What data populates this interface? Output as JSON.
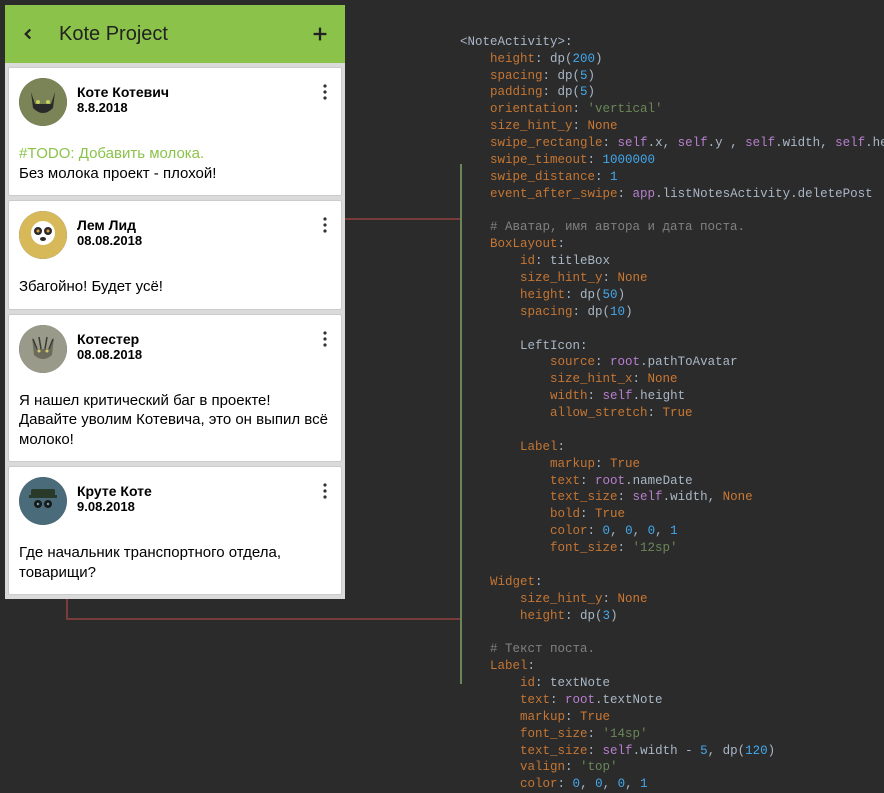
{
  "appbar": {
    "title": "Kote Project"
  },
  "posts": [
    {
      "author": "Коте Котевич",
      "date": "8.8.2018",
      "todo": "#TODO: Добавить молока.",
      "text": "Без молока проект - плохой!",
      "avatar": "cat-dark"
    },
    {
      "author": "Лем Лид",
      "date": "08.08.2018",
      "todo": "",
      "text": "Збагойно! Будет усё!",
      "avatar": "lemur"
    },
    {
      "author": "Котестер",
      "date": "08.08.2018",
      "todo": "",
      "text": "Я нашел критический баг в проекте! Давайте уволим Котевича, это он выпил всё молоко!",
      "avatar": "cat-grey"
    },
    {
      "author": "Круте Коте",
      "date": "9.08.2018",
      "todo": "",
      "text": "Где начальник транспортного отдела, товарищи?",
      "avatar": "cat-cap"
    }
  ],
  "code": {
    "lines": [
      [
        {
          "t": "id",
          "v": "<NoteActivity>:"
        }
      ],
      [
        {
          "t": "prop",
          "v": "    height"
        },
        {
          "t": "id",
          "v": ": dp("
        },
        {
          "t": "num",
          "v": "200"
        },
        {
          "t": "id",
          "v": ")"
        }
      ],
      [
        {
          "t": "prop",
          "v": "    spacing"
        },
        {
          "t": "id",
          "v": ": dp("
        },
        {
          "t": "num",
          "v": "5"
        },
        {
          "t": "id",
          "v": ")"
        }
      ],
      [
        {
          "t": "prop",
          "v": "    padding"
        },
        {
          "t": "id",
          "v": ": dp("
        },
        {
          "t": "num",
          "v": "5"
        },
        {
          "t": "id",
          "v": ")"
        }
      ],
      [
        {
          "t": "prop",
          "v": "    orientation"
        },
        {
          "t": "id",
          "v": ": "
        },
        {
          "t": "str",
          "v": "'vertical'"
        }
      ],
      [
        {
          "t": "prop",
          "v": "    size_hint_y"
        },
        {
          "t": "id",
          "v": ": "
        },
        {
          "t": "kw",
          "v": "None"
        }
      ],
      [
        {
          "t": "prop",
          "v": "    swipe_rectangle"
        },
        {
          "t": "id",
          "v": ": "
        },
        {
          "t": "self",
          "v": "self"
        },
        {
          "t": "id",
          "v": ".x, "
        },
        {
          "t": "self",
          "v": "self"
        },
        {
          "t": "id",
          "v": ".y , "
        },
        {
          "t": "self",
          "v": "self"
        },
        {
          "t": "id",
          "v": ".width, "
        },
        {
          "t": "self",
          "v": "self"
        },
        {
          "t": "id",
          "v": ".height"
        }
      ],
      [
        {
          "t": "prop",
          "v": "    swipe_timeout"
        },
        {
          "t": "id",
          "v": ": "
        },
        {
          "t": "num",
          "v": "1000000"
        }
      ],
      [
        {
          "t": "prop",
          "v": "    swipe_distance"
        },
        {
          "t": "id",
          "v": ": "
        },
        {
          "t": "num",
          "v": "1"
        }
      ],
      [
        {
          "t": "prop",
          "v": "    event_after_swipe"
        },
        {
          "t": "id",
          "v": ": "
        },
        {
          "t": "app",
          "v": "app"
        },
        {
          "t": "id",
          "v": ".listNotesActivity.deletePost"
        }
      ],
      [
        {
          "t": "id",
          "v": ""
        }
      ],
      [
        {
          "t": "cmt",
          "v": "    # Аватар, имя автора и дата поста."
        }
      ],
      [
        {
          "t": "prop",
          "v": "    BoxLayout"
        },
        {
          "t": "id",
          "v": ":"
        }
      ],
      [
        {
          "t": "prop",
          "v": "        id"
        },
        {
          "t": "id",
          "v": ": titleBox"
        }
      ],
      [
        {
          "t": "prop",
          "v": "        size_hint_y"
        },
        {
          "t": "id",
          "v": ": "
        },
        {
          "t": "kw",
          "v": "None"
        }
      ],
      [
        {
          "t": "prop",
          "v": "        height"
        },
        {
          "t": "id",
          "v": ": dp("
        },
        {
          "t": "num",
          "v": "50"
        },
        {
          "t": "id",
          "v": ")"
        }
      ],
      [
        {
          "t": "prop",
          "v": "        spacing"
        },
        {
          "t": "id",
          "v": ": dp("
        },
        {
          "t": "num",
          "v": "10"
        },
        {
          "t": "id",
          "v": ")"
        }
      ],
      [
        {
          "t": "id",
          "v": ""
        }
      ],
      [
        {
          "t": "id",
          "v": "        LeftIcon:"
        }
      ],
      [
        {
          "t": "prop",
          "v": "            source"
        },
        {
          "t": "id",
          "v": ": "
        },
        {
          "t": "self",
          "v": "root"
        },
        {
          "t": "id",
          "v": ".pathToAvatar"
        }
      ],
      [
        {
          "t": "prop",
          "v": "            size_hint_x"
        },
        {
          "t": "id",
          "v": ": "
        },
        {
          "t": "kw",
          "v": "None"
        }
      ],
      [
        {
          "t": "prop",
          "v": "            width"
        },
        {
          "t": "id",
          "v": ": "
        },
        {
          "t": "self",
          "v": "self"
        },
        {
          "t": "id",
          "v": ".height"
        }
      ],
      [
        {
          "t": "prop",
          "v": "            allow_stretch"
        },
        {
          "t": "id",
          "v": ": "
        },
        {
          "t": "kw",
          "v": "True"
        }
      ],
      [
        {
          "t": "id",
          "v": ""
        }
      ],
      [
        {
          "t": "prop",
          "v": "        Label"
        },
        {
          "t": "id",
          "v": ":"
        }
      ],
      [
        {
          "t": "prop",
          "v": "            markup"
        },
        {
          "t": "id",
          "v": ": "
        },
        {
          "t": "kw",
          "v": "True"
        }
      ],
      [
        {
          "t": "prop",
          "v": "            text"
        },
        {
          "t": "id",
          "v": ": "
        },
        {
          "t": "self",
          "v": "root"
        },
        {
          "t": "id",
          "v": ".nameDate"
        }
      ],
      [
        {
          "t": "prop",
          "v": "            text_size"
        },
        {
          "t": "id",
          "v": ": "
        },
        {
          "t": "self",
          "v": "self"
        },
        {
          "t": "id",
          "v": ".width, "
        },
        {
          "t": "kw",
          "v": "None"
        }
      ],
      [
        {
          "t": "prop",
          "v": "            bold"
        },
        {
          "t": "id",
          "v": ": "
        },
        {
          "t": "kw",
          "v": "True"
        }
      ],
      [
        {
          "t": "prop",
          "v": "            color"
        },
        {
          "t": "id",
          "v": ": "
        },
        {
          "t": "num",
          "v": "0"
        },
        {
          "t": "id",
          "v": ", "
        },
        {
          "t": "num",
          "v": "0"
        },
        {
          "t": "id",
          "v": ", "
        },
        {
          "t": "num",
          "v": "0"
        },
        {
          "t": "id",
          "v": ", "
        },
        {
          "t": "num",
          "v": "1"
        }
      ],
      [
        {
          "t": "prop",
          "v": "            font_size"
        },
        {
          "t": "id",
          "v": ": "
        },
        {
          "t": "str",
          "v": "'12sp'"
        }
      ],
      [
        {
          "t": "id",
          "v": ""
        }
      ],
      [
        {
          "t": "prop",
          "v": "    Widget"
        },
        {
          "t": "id",
          "v": ":"
        }
      ],
      [
        {
          "t": "prop",
          "v": "        size_hint_y"
        },
        {
          "t": "id",
          "v": ": "
        },
        {
          "t": "kw",
          "v": "None"
        }
      ],
      [
        {
          "t": "prop",
          "v": "        height"
        },
        {
          "t": "id",
          "v": ": dp("
        },
        {
          "t": "num",
          "v": "3"
        },
        {
          "t": "id",
          "v": ")"
        }
      ],
      [
        {
          "t": "id",
          "v": ""
        }
      ],
      [
        {
          "t": "cmt",
          "v": "    # Текст поста."
        }
      ],
      [
        {
          "t": "prop",
          "v": "    Label"
        },
        {
          "t": "id",
          "v": ":"
        }
      ],
      [
        {
          "t": "prop",
          "v": "        id"
        },
        {
          "t": "id",
          "v": ": textNote"
        }
      ],
      [
        {
          "t": "prop",
          "v": "        text"
        },
        {
          "t": "id",
          "v": ": "
        },
        {
          "t": "self",
          "v": "root"
        },
        {
          "t": "id",
          "v": ".textNote"
        }
      ],
      [
        {
          "t": "prop",
          "v": "        markup"
        },
        {
          "t": "id",
          "v": ": "
        },
        {
          "t": "kw",
          "v": "True"
        }
      ],
      [
        {
          "t": "prop",
          "v": "        font_size"
        },
        {
          "t": "id",
          "v": ": "
        },
        {
          "t": "str",
          "v": "'14sp'"
        }
      ],
      [
        {
          "t": "prop",
          "v": "        text_size"
        },
        {
          "t": "id",
          "v": ": "
        },
        {
          "t": "self",
          "v": "self"
        },
        {
          "t": "id",
          "v": ".width - "
        },
        {
          "t": "num",
          "v": "5"
        },
        {
          "t": "id",
          "v": ", dp("
        },
        {
          "t": "num",
          "v": "120"
        },
        {
          "t": "id",
          "v": ")"
        }
      ],
      [
        {
          "t": "prop",
          "v": "        valign"
        },
        {
          "t": "id",
          "v": ": "
        },
        {
          "t": "str",
          "v": "'top'"
        }
      ],
      [
        {
          "t": "prop",
          "v": "        color"
        },
        {
          "t": "id",
          "v": ": "
        },
        {
          "t": "num",
          "v": "0"
        },
        {
          "t": "id",
          "v": ", "
        },
        {
          "t": "num",
          "v": "0"
        },
        {
          "t": "id",
          "v": ", "
        },
        {
          "t": "num",
          "v": "0"
        },
        {
          "t": "id",
          "v": ", "
        },
        {
          "t": "num",
          "v": "1"
        }
      ]
    ]
  }
}
